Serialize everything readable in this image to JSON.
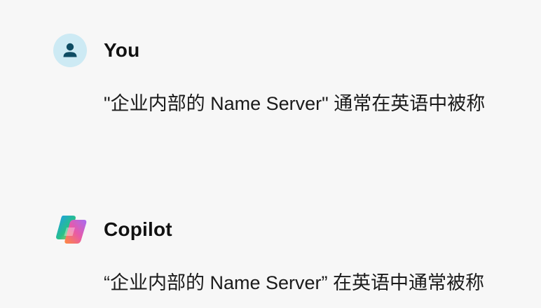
{
  "conversation": {
    "messages": [
      {
        "author": "You",
        "avatar_icon": "user-icon",
        "text": "\"企业内部的 Name Server\" 通常在英语中被称"
      },
      {
        "author": "Copilot",
        "avatar_icon": "copilot-logo-icon",
        "text": "“企业内部的 Name Server” 在英语中通常被称"
      }
    ]
  },
  "colors": {
    "background": "#f7f7f7",
    "user_avatar_bg": "#cdeaf4",
    "user_avatar_fg": "#0e4c63"
  }
}
